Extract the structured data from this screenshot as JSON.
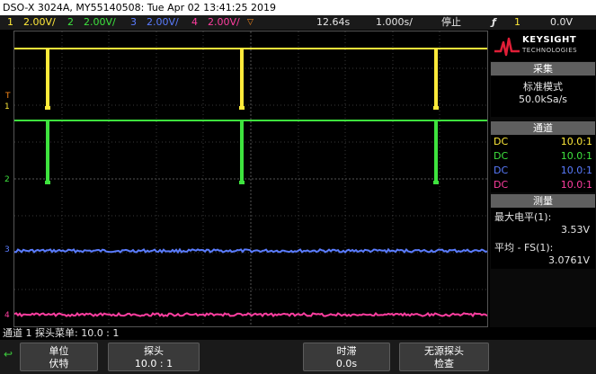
{
  "window": {
    "title": "DSO-X 3024A, MY55140508: Tue Apr 02 13:41:25 2019"
  },
  "status_bar": {
    "ch1_num": "1",
    "ch1_scale": "2.00V/",
    "ch2_num": "2",
    "ch2_scale": "2.00V/",
    "ch3_num": "3",
    "ch3_scale": "2.00V/",
    "ch4_num": "4",
    "ch4_scale": "2.00V/",
    "trigger_marker": "▽",
    "time_position": "12.64s",
    "time_scale": "1.000s/",
    "run_state": "停止",
    "trigger_icon": "ƒ",
    "trigger_channel": "1",
    "trigger_level": "0.0V"
  },
  "markers": {
    "ch1": "1",
    "ch2": "2",
    "ch3": "3",
    "ch4": "4",
    "trigger": "T"
  },
  "panel": {
    "brand": "KEYSIGHT",
    "brand_sub": "TECHNOLOGIES",
    "acq_header": "采集",
    "acq_mode": "标准模式",
    "acq_rate": "50.0kSa/s",
    "channel_header": "通道",
    "channels": [
      {
        "coupling": "DC",
        "probe": "10.0:1",
        "color": "#ffea3a"
      },
      {
        "coupling": "DC",
        "probe": "10.0:1",
        "color": "#3ee33e"
      },
      {
        "coupling": "DC",
        "probe": "10.0:1",
        "color": "#5a7cff"
      },
      {
        "coupling": "DC",
        "probe": "10.0:1",
        "color": "#ff3ea0"
      }
    ],
    "meas_header": "测量",
    "meas1_label": "最大电平(1):",
    "meas1_value": "3.53V",
    "meas2_label": "平均 - FS(1):",
    "meas2_value": "3.0761V"
  },
  "channel_menu": {
    "text": "通道 1 探头菜单: 10.0 : 1"
  },
  "softkeys": [
    {
      "line1": "单位",
      "line2": "伏特"
    },
    {
      "line1": "探头",
      "line2": "10.0 : 1"
    },
    {
      "line1": "时滞",
      "line2": "0.0s"
    },
    {
      "line1": "无源探头",
      "line2": "检查"
    }
  ],
  "colors": {
    "ch1": "#ffea3a",
    "ch2": "#3ee33e",
    "ch3": "#5a7cff",
    "ch4": "#ff3ea0",
    "trigger": "#ff8c1a",
    "softkey_accent": "#3dcc3d"
  }
}
